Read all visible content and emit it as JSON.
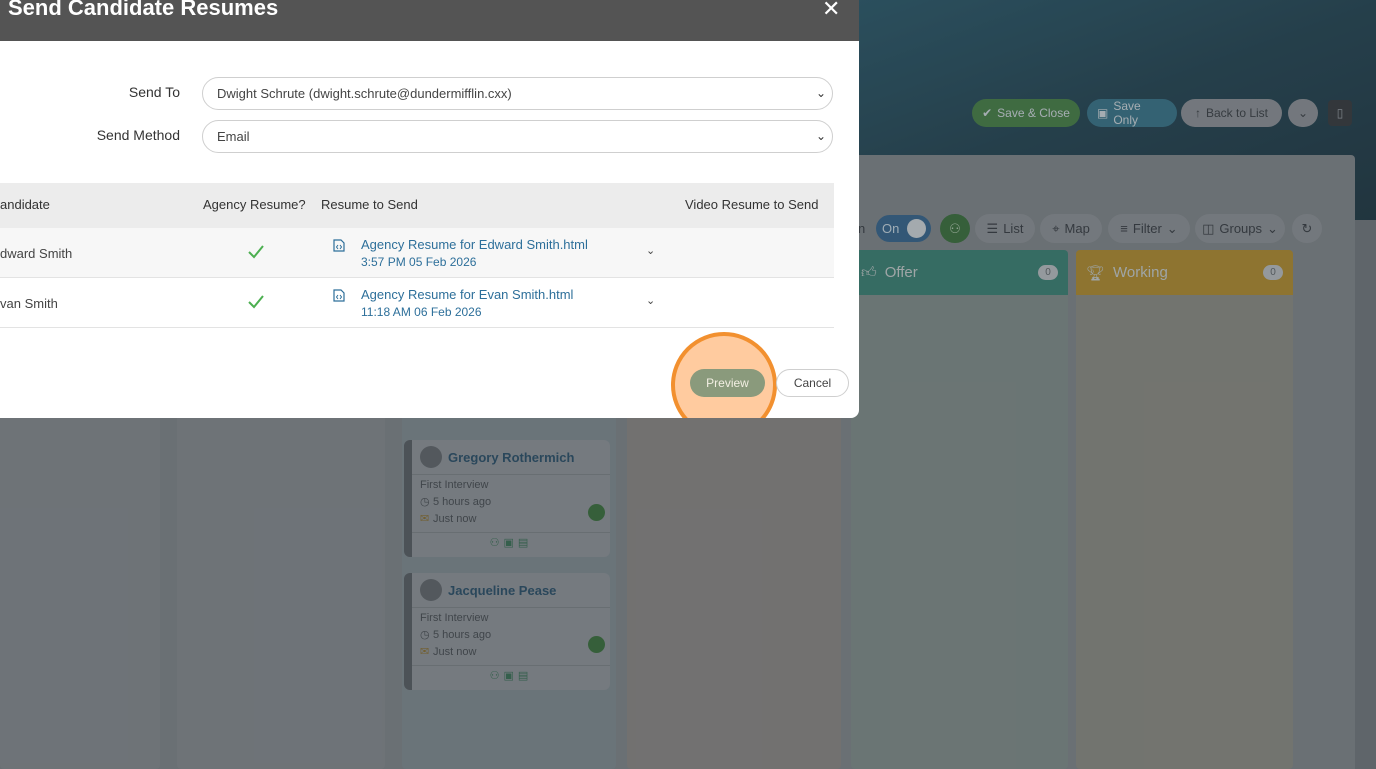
{
  "background": {
    "toolbar_buttons": {
      "save_close": "Save & Close",
      "save_only": "Save Only",
      "back_to_list": "Back to List"
    },
    "toolbar": {
      "toggle_label_fragment": "n",
      "toggle_value": "On",
      "list": "List",
      "map": "Map",
      "filter": "Filter",
      "groups": "Groups"
    },
    "columns": [
      {
        "title": "Offer",
        "count": "0",
        "color": "#2e7f6e"
      },
      {
        "title": "Working",
        "count": "0",
        "color": "#b58a1f"
      }
    ],
    "cards": [
      {
        "name": "Gregory Rothermich",
        "stage": "First Interview",
        "time": "5 hours ago",
        "contact": "Just now"
      },
      {
        "name": "Jacqueline Pease",
        "stage": "First Interview",
        "time": "5 hours ago",
        "contact": "Just now"
      }
    ]
  },
  "modal": {
    "title": "Send Candidate Resumes",
    "close_icon": "close-icon",
    "send_to_label": "Send To",
    "send_to_value": "Dwight Schrute (dwight.schrute@dundermifflin.cxx)",
    "send_method_label": "Send Method",
    "send_method_value": "Email",
    "table": {
      "headers": [
        "andidate",
        "Agency Resume?",
        "Resume to Send",
        "Video Resume to Send"
      ],
      "rows": [
        {
          "candidate": "dward Smith",
          "resume": "Agency Resume for Edward Smith.html",
          "date": "3:57 PM 05 Feb 2026"
        },
        {
          "candidate": "van Smith",
          "resume": "Agency Resume for Evan Smith.html",
          "date": "11:18 AM 06 Feb 2026"
        }
      ]
    },
    "preview_button": "Preview",
    "cancel_button": "Cancel"
  },
  "colors": {
    "header_bg": "#545454",
    "link": "#2d6f9a",
    "check": "#4caf50",
    "highlight": "#f2902f"
  }
}
